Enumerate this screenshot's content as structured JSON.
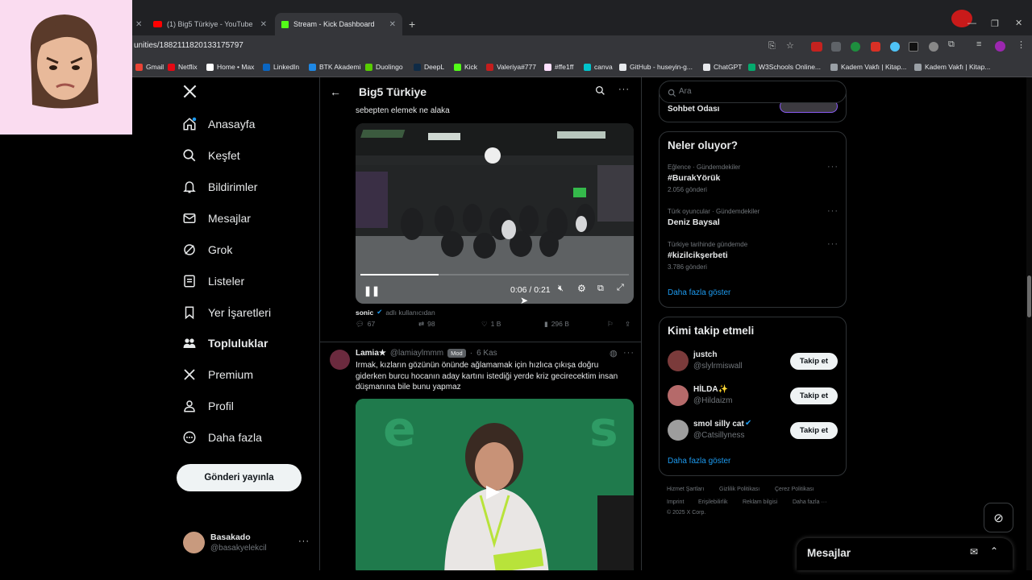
{
  "browser": {
    "tabs": [
      {
        "title": "(1) Big5 Türkiye - YouTube"
      },
      {
        "title": "Stream - Kick Dashboard"
      }
    ],
    "url": "unities/1882111820133175797",
    "bookmarks": [
      "Gmail",
      "Netflix",
      "Home • Max",
      "LinkedIn",
      "BTK Akademi",
      "Duolingo",
      "DeepL",
      "Kick",
      "Valeriya#777",
      "#ffe1ff",
      "canva",
      "GitHub - huseyin-g...",
      "ChatGPT",
      "W3Schools Online...",
      "Kadem Vakfı | Kitap...",
      "Kadem Vakfı | Kitap..."
    ]
  },
  "sidebar": {
    "items": [
      {
        "label": "Anasayfa",
        "icon": "home-icon"
      },
      {
        "label": "Keşfet",
        "icon": "search-icon"
      },
      {
        "label": "Bildirimler",
        "icon": "bell-icon"
      },
      {
        "label": "Mesajlar",
        "icon": "mail-icon"
      },
      {
        "label": "Grok",
        "icon": "grok-icon"
      },
      {
        "label": "Listeler",
        "icon": "list-icon"
      },
      {
        "label": "Yer İşaretleri",
        "icon": "bookmark-icon"
      },
      {
        "label": "Topluluklar",
        "icon": "communities-icon"
      },
      {
        "label": "Premium",
        "icon": "x-logo-icon"
      },
      {
        "label": "Profil",
        "icon": "profile-icon"
      },
      {
        "label": "Daha fazla",
        "icon": "more-circle-icon"
      }
    ],
    "post_button": "Gönderi yayınla",
    "account": {
      "name": "Basakado",
      "handle": "@basakyelekcil"
    }
  },
  "feed": {
    "header_title": "Big5 Türkiye",
    "post1": {
      "text_tail": "sebepten elemek ne alaka",
      "video_time": "0:06 / 0:21",
      "progress": 0.29,
      "attribution_name": "sonic",
      "attribution_note": "adlı kullanıcıdan",
      "replies": "67",
      "reposts": "98",
      "likes": "1 B",
      "views": "296 B"
    },
    "post2": {
      "name": "Lamia★",
      "handle": "@lamiaylmmm",
      "badge": "Mod",
      "date": "6 Kas",
      "text": "Irmak, kızların gözünün önünde ağlamamak için hızlıca çıkışa doğru giderken burcu hocanın aday kartını istediği yerde kriz gecirecektim insan düşmanına bile bunu yapmaz"
    }
  },
  "right": {
    "search_placeholder": "Ara",
    "chat_room": "Sohbet Odası",
    "trends_title": "Neler oluyor?",
    "trends": [
      {
        "category": "Eğlence · Gündemdekiler",
        "name": "#BurakYörük",
        "count": "2.056 gönderi"
      },
      {
        "category": "Türk oyuncular · Gündemdekiler",
        "name": "Deniz Baysal",
        "count": ""
      },
      {
        "category": "Türkiye tarihinde gündemde",
        "name": "#kizilcikşerbeti",
        "count": "3.786 gönderi"
      }
    ],
    "show_more": "Daha fazla göster",
    "follow_title": "Kimi takip etmeli",
    "follow": [
      {
        "name": "justch",
        "handle": "@slylrmiswall"
      },
      {
        "name": "HİLDA✨",
        "handle": "@Hildaizm"
      },
      {
        "name": "smol silly cat",
        "handle": "@Catsillyness"
      }
    ],
    "follow_button": "Takip et",
    "footer": [
      "Hizmet Şartları",
      "Gizlilik Politikası",
      "Çerez Politikası",
      "Imprint",
      "Erişilebilirlik",
      "Reklam bilgisi",
      "Daha fazla ···",
      "© 2025 X Corp."
    ]
  },
  "messages_dock": {
    "title": "Mesajlar"
  },
  "colors": {
    "accent": "#1d9bf0",
    "bg": "#000000",
    "border": "#2f3336"
  }
}
